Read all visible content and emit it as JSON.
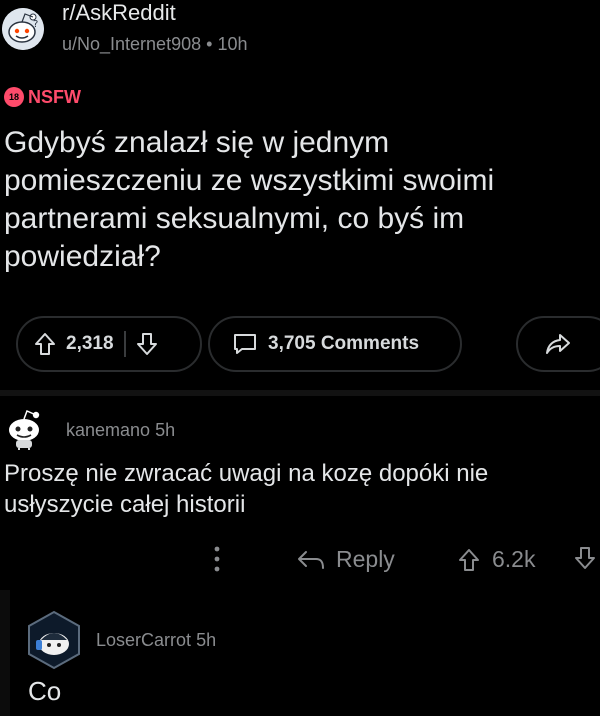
{
  "post": {
    "subreddit": "r/AskReddit",
    "author": "u/No_Internet908",
    "time": "10h",
    "nsfw_badge": "18",
    "nsfw_label": "NSFW",
    "title": "Gdybyś znalazł się w jednym pomieszczeniu ze wszystkimi swoimi partnerami seksualnymi, co byś im powiedział?",
    "upvotes": "2,318",
    "comments_label": "3,705 Comments",
    "icons": [
      "upvote-icon",
      "downvote-icon",
      "comment-icon",
      "share-icon"
    ]
  },
  "comments": [
    {
      "user": "kanemano",
      "time": "5h",
      "body": "Proszę nie zwracać uwagi na kozę dopóki nie usłyszycie całej historii",
      "reply_label": "Reply",
      "score": "6.2k"
    },
    {
      "user": "LoserCarrot",
      "time": "5h",
      "body": "Co"
    }
  ],
  "colors": {
    "background": "#000000",
    "text": "#e4e6e8",
    "muted": "#8a8c8f",
    "nsfw": "#ff4b6b"
  }
}
